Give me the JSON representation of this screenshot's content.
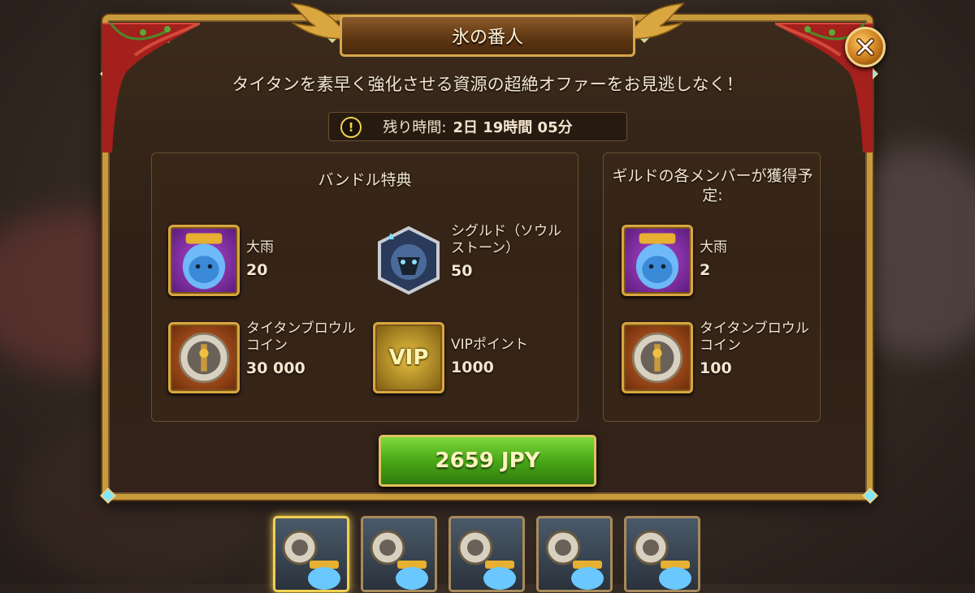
{
  "title": "氷の番人",
  "headline": "タイタンを素早く強化させる資源の超絶オファーをお見逃しなく！",
  "timer": {
    "label": "残り時間:",
    "value": "2日 19時間 05分"
  },
  "bundle_section": {
    "title": "バンドル特典",
    "items": [
      {
        "name": "大雨",
        "qty": "20",
        "icon": "rain-jar-icon"
      },
      {
        "name": "シグルド（ソウルストーン）",
        "qty": "50",
        "icon": "sigurd-soulstone-icon"
      },
      {
        "name": "タイタンブロウルコイン",
        "qty": "30 000",
        "icon": "titan-brawl-coin-icon"
      },
      {
        "name": "VIPポイント",
        "qty": "1000",
        "icon": "vip-points-icon"
      }
    ]
  },
  "guild_section": {
    "title": "ギルドの各メンバーが獲得予定:",
    "items": [
      {
        "name": "大雨",
        "qty": "2",
        "icon": "rain-jar-icon"
      },
      {
        "name": "タイタンブロウルコイン",
        "qty": "100",
        "icon": "titan-brawl-coin-icon"
      }
    ]
  },
  "buy_button": "2659 JPY",
  "vip_badge": "VIP",
  "close_icon": "close-icon",
  "bundle_tabs_count": 5,
  "colors": {
    "gold": "#c89a3c",
    "buy_green": "#4aa818",
    "text": "#f3e6cf"
  }
}
